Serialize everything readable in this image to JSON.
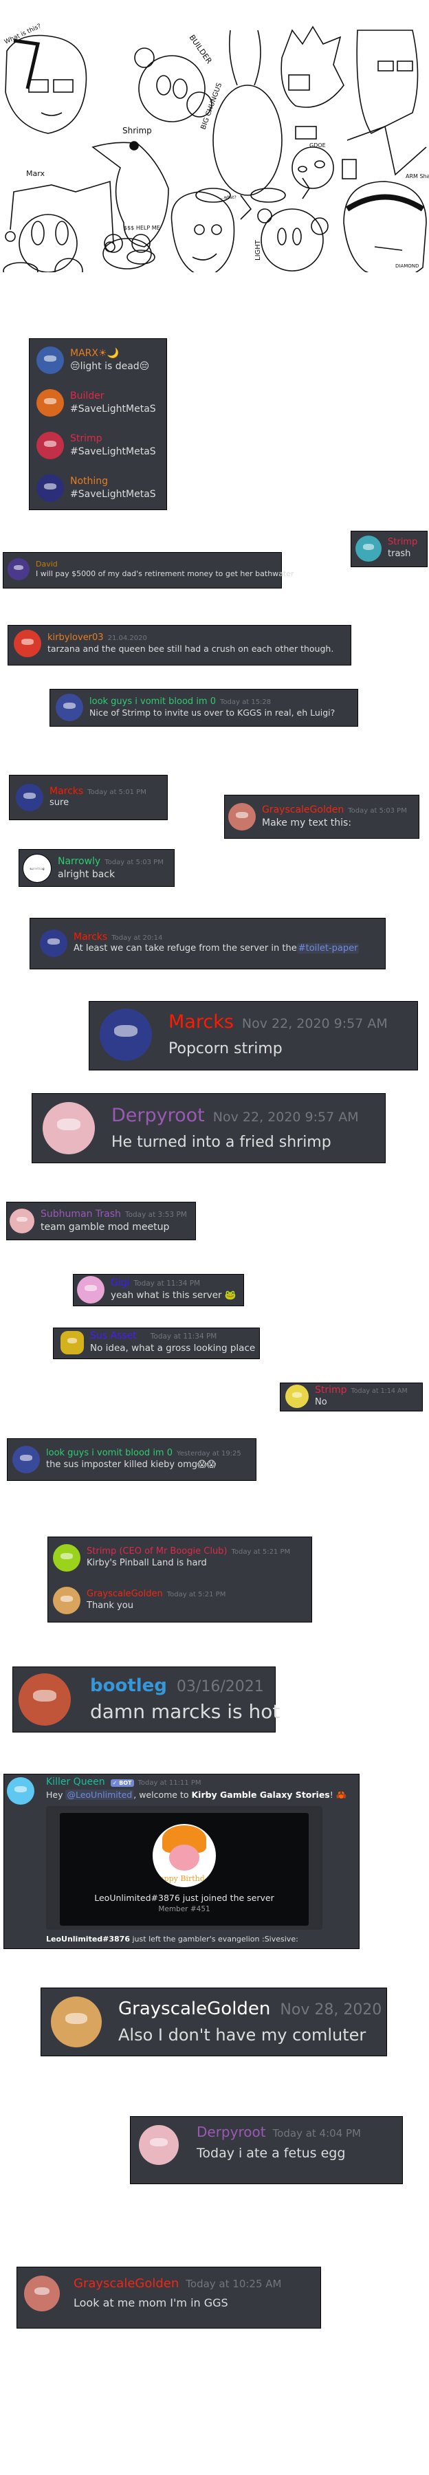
{
  "drawing": {
    "labels": [
      "What is this?",
      "BUILDER",
      "Shrimp",
      "BIG CHUNGUS",
      "Marx",
      "GDOE",
      "ARM Sharg",
      "LIGHT",
      "$$$ HELP ME",
      "DIAMOND",
      "...what?"
    ]
  },
  "colors": {
    "panel": "#36393f",
    "text": "#dcddde",
    "timestamp": "#72767d",
    "mention": "#7289da"
  },
  "boxes": [
    {
      "messages": [
        {
          "name": "MARX☀🌙",
          "name_color": "#e67e22",
          "avatar_color": "#3b5fa8",
          "text": "😔light is dead😔"
        },
        {
          "name": "Builder",
          "name_color": "#e0294a",
          "avatar_color": "#d8691e",
          "text": "#SaveLightMetaS"
        },
        {
          "name": "Strimp",
          "name_color": "#e0294a",
          "avatar_color": "#c23048",
          "text": "#SaveLightMetaS"
        },
        {
          "name": "Nothing",
          "name_color": "#e67e22",
          "avatar_color": "#2b2f7a",
          "text": "#SaveLightMetaS"
        }
      ]
    },
    {
      "messages": [
        {
          "name": "Strimp",
          "name_color": "#e0294a",
          "avatar_color": "#3fa9b8",
          "text": "trash"
        }
      ]
    },
    {
      "messages": [
        {
          "name": "David",
          "name_color": "#c27c0e",
          "avatar_color": "#4b3a8c",
          "text": "I will pay $5000 of my dad's retirement money to get her bathwater"
        }
      ]
    },
    {
      "messages": [
        {
          "name": "kirbylover03",
          "time": "21.04.2020",
          "name_color": "#e67e22",
          "avatar_color": "#d93a2b",
          "text": "tarzana and the queen bee still had a crush on each other though."
        }
      ]
    },
    {
      "messages": [
        {
          "name": "look guys i vomit blood im 0",
          "time": "Today at 15:28",
          "name_color": "#2ecc71",
          "avatar_color": "#3a4a9a",
          "text": "Nice of Strimp to invite us over to KGGS in real, eh Luigi?"
        }
      ]
    },
    {
      "messages": [
        {
          "name": "Marcks",
          "time": "Today at 5:01 PM",
          "name_color": "#ff1a00",
          "avatar_color": "#2f3c8c",
          "text": "sure"
        }
      ]
    },
    {
      "messages": [
        {
          "name": "GrayscaleGolden",
          "time": "Today at 5:03 PM",
          "name_color": "#f22613",
          "avatar_color": "#c8776a",
          "text": "Make my text this:"
        }
      ]
    },
    {
      "messages": [
        {
          "name": "Narrowly",
          "time": "Today at 5:03 PM",
          "name_color": "#2ecc71",
          "avatar_color": "#ffffff",
          "avatar_text": "something",
          "text": "alright back"
        }
      ]
    },
    {
      "messages": [
        {
          "name": "Marcks",
          "time": "Today at 20:14",
          "name_color": "#ff1a00",
          "avatar_color": "#2f3c8c",
          "text": "At least we can take refuge from the server in the",
          "channel": "#toilet-paper"
        }
      ]
    },
    {
      "messages": [
        {
          "name": "Marcks",
          "time": "Nov 22, 2020 9:57 AM",
          "name_color": "#ff1a00",
          "avatar_color": "#2f3c8c",
          "text": "Popcorn strimp"
        }
      ]
    },
    {
      "messages": [
        {
          "name": "Derpyroot",
          "time": "Nov 22, 2020 9:57 AM",
          "name_color": "#9b59b6",
          "avatar_color": "#e9b7c0",
          "text": "He turned into a fried shrimp"
        }
      ]
    },
    {
      "messages": [
        {
          "name": "Subhuman Trash",
          "time": "Today at 3:53 PM",
          "name_color": "#9b59b6",
          "avatar_color": "#e8b4b8",
          "text": "team gamble mod meetup"
        }
      ]
    },
    {
      "messages": [
        {
          "name": "Gigi",
          "time": "Today at 11:34 PM",
          "name_color": "#3d1bff",
          "avatar_color": "#e7a6d6",
          "text": "yeah what is this server 🐸"
        }
      ]
    },
    {
      "messages": [
        {
          "name": "Sus Asset",
          "time": "Today at 11:34 PM",
          "name_color": "#4a1bff",
          "avatar_color": "#d4b21e",
          "text": "No idea, what a gross looking place"
        }
      ]
    },
    {
      "messages": [
        {
          "name": "Strimp",
          "time": "Today at 1:14 AM",
          "name_color": "#e0294a",
          "avatar_color": "#e8d548",
          "text": "No"
        }
      ]
    },
    {
      "messages": [
        {
          "name": "look guys i vomit blood im 0",
          "time": "Yesterday at 19:25",
          "name_color": "#2ecc71",
          "avatar_color": "#3a4a9a",
          "text": "the sus imposter killed kieby omg😱😱"
        }
      ]
    },
    {
      "messages": [
        {
          "name": "Strimp (CEO of Mr Boogie Club)",
          "time": "Today at 5:21 PM",
          "name_color": "#e0294a",
          "avatar_color": "#9ad21c",
          "text": "Kirby's Pinball Land is hard"
        },
        {
          "name": "GrayscaleGolden",
          "time": "Today at 5:21 PM",
          "name_color": "#f22613",
          "avatar_color": "#d9a55e",
          "text": "Thank you"
        }
      ]
    },
    {
      "messages": [
        {
          "name": "bootleg",
          "time": "03/16/2021",
          "name_color": "#3498db",
          "avatar_color": "#c0553a",
          "text": "damn marcks is hot"
        }
      ]
    },
    {
      "messages": [
        {
          "name": "Killer Queen",
          "badge": "✓ BOT",
          "time": "Today at 11:11 PM",
          "name_color": "#1abc9c",
          "avatar_color": "#5ec8f2",
          "text_prefix": "Hey ",
          "mention": "@LeoUnlimited",
          "text_middle": ", welcome to ",
          "server": "Kirby Gamble Galaxy Stories",
          "text_suffix": "! 🦀",
          "embed": {
            "joined": "LeoUnlimited#3876 just joined the server",
            "member": "Member #451",
            "image_caption": "appy Birthd"
          },
          "left_user": "LeoUnlimited#3876",
          "left_text": " just left the gambler's evangelion :Sivesive:"
        }
      ]
    },
    {
      "messages": [
        {
          "name": "GrayscaleGolden",
          "time": "Nov 28, 2020",
          "name_color": "#ffffff",
          "avatar_color": "#d9a55e",
          "text": "Also I don't have my comluter"
        }
      ]
    },
    {
      "messages": [
        {
          "name": "Derpyroot",
          "time": "Today at 4:04 PM",
          "name_color": "#9b59b6",
          "avatar_color": "#e9b7c0",
          "text": "Today i ate a fetus egg"
        }
      ]
    },
    {
      "messages": [
        {
          "name": "GrayscaleGolden",
          "time": "Today at 10:25 AM",
          "name_color": "#f22613",
          "avatar_color": "#c8776a",
          "text": "Look at me mom I'm in GGS"
        }
      ]
    }
  ]
}
